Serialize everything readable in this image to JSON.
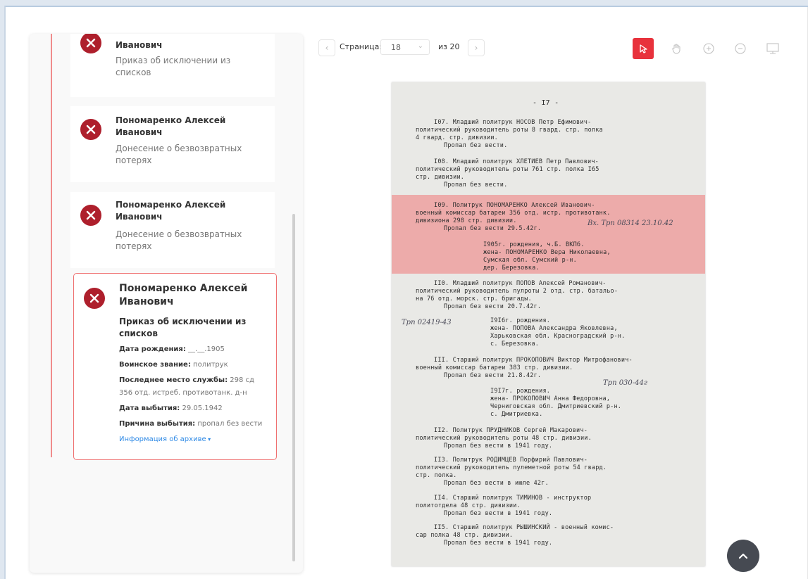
{
  "records": [
    {
      "name": "Иванович",
      "document": "Приказ об исключении из списков"
    },
    {
      "name": "Пономаренко Алексей Иванович",
      "document": "Донесение о безвозвратных потерях"
    },
    {
      "name": "Пономаренко Алексей Иванович",
      "document": "Донесение о безвозвратных потерях"
    },
    {
      "name": "Пономаренко Алексей Иванович",
      "document": "Приказ об исключении из списков",
      "birth_label": "Дата рождения:",
      "birth_value": "__.__.1905",
      "rank_label": "Воинское звание:",
      "rank_value": "политрук",
      "service_label": "Последнее место службы:",
      "service_value_1": "298 сд",
      "service_value_2": "356 отд. истреб. противотанк. д-н",
      "departure_label": "Дата выбытия:",
      "departure_value": "29.05.1942",
      "reason_label": "Причина выбытия:",
      "reason_value": "пропал без вести",
      "archive_link": "Информация об архиве"
    }
  ],
  "toolbar": {
    "page_label": "Страница:",
    "current_page": "18",
    "total_pages": "из 20",
    "active_tool": "cursor"
  },
  "colors": {
    "accent": "#e8323c",
    "error_icon": "#ae1f2c",
    "link": "#2f8ae6",
    "highlight": "#f07878"
  },
  "document_text": {
    "header": "- I7 -",
    "e107_1": "I07. Младший политрук НОСОВ Петр Ефимович-",
    "e107_2": "политический руководитель роты 8 гвард. стр. полка",
    "e107_3": "4 гвард. стр. дивизии.",
    "e107_4": "Пропал без вести.",
    "e108_1": "I08. Младший политрук ХЛЕТИЕВ Петр Павлович-",
    "e108_2": "политический руководитель роты 761 стр. полка I65",
    "e108_3": "стр. дивизии.",
    "e108_4": "Пропал без вести.",
    "e109_1": "I09. Политрук ПОНОМАРЕНКО Алексей Иванович-",
    "e109_2": "военный комиссар батареи 356 отд. истр. противотанк.",
    "e109_3": "дивизиона 298 стр. дивизии.",
    "e109_4": "Пропал без вести 29.5.42г.",
    "e109_hw": "Вх. Трп 08314 23.10.42",
    "e109_5": "I905г. рождения, ч.Б. ВКПб.",
    "e109_6": "жена- ПОНОМАРЕНКО Вера Николаевна,",
    "e109_7": "Сумская обл. Сумский р-н.",
    "e109_8": "дер. Березовка.",
    "e110_1": "II0. Младший политрук ПОПОВ Алексей Романович-",
    "e110_2": "политический руководитель пулроты 2 отд. стр. батальо-",
    "e110_3": "на 76 отд. морск. стр. бригады.",
    "e110_4": "Пропал без вести 20.7.42г.",
    "e110_hw": "Трп 02419-43",
    "e110_5": "I9I6г. рождения.",
    "e110_6": "жена- ПОПОВА Александра Яковлевна,",
    "e110_7": "Харьковская обл. Красноградский р-н.",
    "e110_8": "с. Березовка.",
    "e111_1": "III. Старший политрук ПРОКОПОВИЧ Виктор Митрофанович-",
    "e111_2": "военный комиссар батареи 383 стр. дивизии.",
    "e111_3": "Пропал без вести 21.8.42г.",
    "e111_hw": "Трп 030-44г",
    "e111_4": "I9I7г. рождения.",
    "e111_5": "жена- ПРОКОПОВИЧ Анна Федоровна,",
    "e111_6": "Черниговская обл. Дмитриевский р-н.",
    "e111_7": "с. Дмитриевка.",
    "e112_1": "II2. Политрук ПРУДНИКОВ Сергей Макарович-",
    "e112_2": "политический руководитель роты 48 стр. дивизии.",
    "e112_3": "Пропал без вести в 1941 году.",
    "e113_1": "II3. Политрук РОДИМЦЕВ Порфирий Павлович-",
    "e113_2": "политический руководитель пулеметной роты 54 гвард.",
    "e113_3": "стр. полка.",
    "e113_4": "Пропал без вести в июле 42г.",
    "e114_1": "II4. Старший политрук ТИМИНОВ - инструктор",
    "e114_2": "политотдела 48 стр. дивизии.",
    "e114_3": "Пропал без вести в 1941 году.",
    "e115_1": "II5. Старший политрук РЫШИНСКИЙ - военный комис-",
    "e115_2": "сар полка 48 стр. дивизии.",
    "e115_3": "Пропал без вести в 1941 году."
  }
}
